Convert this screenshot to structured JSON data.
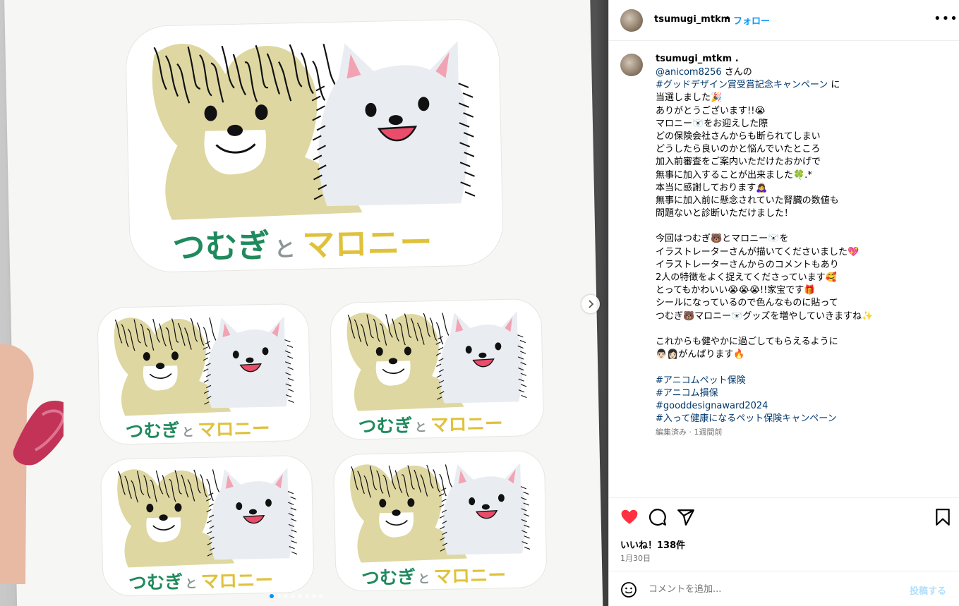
{
  "media": {
    "sticker_text_part1": "つむぎ",
    "sticker_text_part2": "と",
    "sticker_text_part3": "マロニー",
    "carousel_count": 8,
    "carousel_active": 0,
    "colors": {
      "green": "#1f8a5d",
      "yellow": "#e0c13a",
      "grey": "#8c9595",
      "tan": "#ded7a1",
      "white_dog": "#e9edf1"
    }
  },
  "header": {
    "username": "tsumugi_mtkm",
    "separator": "•",
    "follow_label": "フォロー",
    "more_label": "•••"
  },
  "caption": {
    "username": "tsumugi_mtkm .",
    "lines": [
      {
        "parts": [
          {
            "t": "@anicom8256",
            "link": true
          },
          {
            "t": " さんの",
            "link": false
          }
        ]
      },
      {
        "parts": [
          {
            "t": "#グッドデザイン賞受賞記念キャンペーン",
            "link": true
          },
          {
            "t": " に",
            "link": false
          }
        ]
      },
      {
        "parts": [
          {
            "t": "当選しました🎉",
            "link": false
          }
        ]
      },
      {
        "parts": [
          {
            "t": "ありがとうございます!!😭",
            "link": false
          }
        ]
      },
      {
        "parts": [
          {
            "t": "マロニー🐻‍❄️をお迎えした際",
            "link": false
          }
        ]
      },
      {
        "parts": [
          {
            "t": "どの保険会社さんからも断られてしまい",
            "link": false
          }
        ]
      },
      {
        "parts": [
          {
            "t": "どうしたら良いのかと悩んでいたところ",
            "link": false
          }
        ]
      },
      {
        "parts": [
          {
            "t": "加入前審査をご案内いただけたおかげで",
            "link": false
          }
        ]
      },
      {
        "parts": [
          {
            "t": "無事に加入することが出来ました🍀.*",
            "link": false
          }
        ]
      },
      {
        "parts": [
          {
            "t": "本当に感謝しております🙇‍♀️",
            "link": false
          }
        ]
      },
      {
        "parts": [
          {
            "t": "無事に加入前に懸念されていた腎臓の数値も",
            "link": false
          }
        ]
      },
      {
        "parts": [
          {
            "t": "問題ないと診断いただけました！",
            "link": false
          }
        ]
      },
      {
        "parts": [
          {
            "t": "",
            "link": false
          }
        ]
      },
      {
        "parts": [
          {
            "t": "今回はつむぎ🐻とマロニー🐻‍❄️を",
            "link": false
          }
        ]
      },
      {
        "parts": [
          {
            "t": "イラストレーターさんが描いてくださいました💖",
            "link": false
          }
        ]
      },
      {
        "parts": [
          {
            "t": "イラストレーターさんからのコメントもあり",
            "link": false
          }
        ]
      },
      {
        "parts": [
          {
            "t": "2人の特徴をよく捉えてくださっています🥰",
            "link": false
          }
        ]
      },
      {
        "parts": [
          {
            "t": "とってもかわいい😭😭😭!!家宝です🎁",
            "link": false
          }
        ]
      },
      {
        "parts": [
          {
            "t": "シールになっているので色んなものに貼って",
            "link": false
          }
        ]
      },
      {
        "parts": [
          {
            "t": "つむぎ🐻マロニー🐻‍❄️グッズを増やしていきますね✨",
            "link": false
          }
        ]
      },
      {
        "parts": [
          {
            "t": "",
            "link": false
          }
        ]
      },
      {
        "parts": [
          {
            "t": "これからも健やかに過ごしてもらえるように",
            "link": false
          }
        ]
      },
      {
        "parts": [
          {
            "t": "👨🏻👩🏻がんばります🔥",
            "link": false
          }
        ]
      },
      {
        "parts": [
          {
            "t": "",
            "link": false
          }
        ]
      },
      {
        "parts": [
          {
            "t": "#アニコムペット保険",
            "link": true
          }
        ]
      },
      {
        "parts": [
          {
            "t": "#アニコム損保",
            "link": true
          }
        ]
      },
      {
        "parts": [
          {
            "t": "#gooddesignaward2024",
            "link": true
          }
        ]
      },
      {
        "parts": [
          {
            "t": "#入って健康になるペット保険キャンペーン",
            "link": true
          }
        ]
      }
    ],
    "meta": "編集済み · 1週間前"
  },
  "actions": {
    "likes": "いいね！138件",
    "date": "1月30日",
    "liked": true,
    "heart_color": "#ff3040"
  },
  "comment": {
    "placeholder": "コメントを追加...",
    "post_label": "投稿する"
  }
}
